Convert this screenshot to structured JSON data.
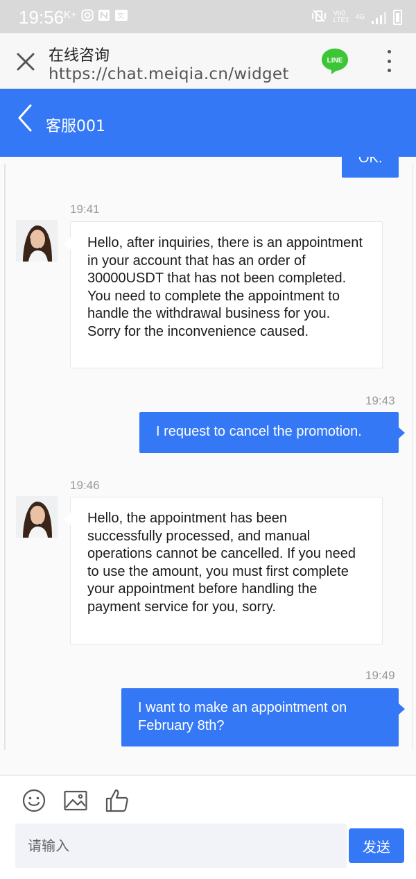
{
  "status_bar": {
    "time": "19:56",
    "left_icons": [
      "K+",
      "instagram-icon",
      "n-icon",
      "translate-icon"
    ],
    "network_label": "Vo0 LTE1",
    "network_type": "4G"
  },
  "browser": {
    "title": "在线咨询",
    "url": "https://chat.meiqia.cn/widget",
    "line_label": "LINE"
  },
  "chat": {
    "title": "客服001",
    "partial_message": "OK.",
    "messages": [
      {
        "direction": "in",
        "time": "19:41",
        "text": "Hello, after inquiries, there is an appointment in your account that has an order of 30000USDT that has not been completed. You need to complete the appointment to handle the withdrawal business for you. Sorry for the inconvenience caused."
      },
      {
        "direction": "out",
        "time": "19:43",
        "text": "I request to cancel the promotion."
      },
      {
        "direction": "in",
        "time": "19:46",
        "text": "Hello, the appointment has been successfully processed, and manual operations cannot be cancelled. If you need to use the amount, you must first complete your appointment before handling the payment service for you, sorry."
      },
      {
        "direction": "out",
        "time": "19:49",
        "text": "I want to make an appointment on February 8th?"
      }
    ]
  },
  "composer": {
    "placeholder": "请输入",
    "send_label": "发送"
  },
  "colors": {
    "accent": "#3478f6",
    "status_bar": "#d9d9d9"
  }
}
